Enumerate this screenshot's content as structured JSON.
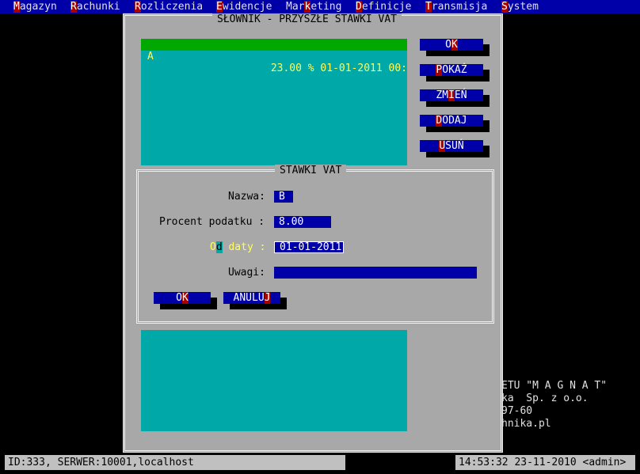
{
  "menu": [
    {
      "hot": "M",
      "rest": "agazyn"
    },
    {
      "hot": "R",
      "rest": "achunki"
    },
    {
      "hot": "R",
      "rest": "ozliczenia"
    },
    {
      "hot": "E",
      "rest": "widencje"
    },
    {
      "pre": "Mar",
      "hot": "k",
      "rest": "eting"
    },
    {
      "hot": "D",
      "rest": "efinicje"
    },
    {
      "hot": "T",
      "rest": "ransmisja"
    },
    {
      "hot": "S",
      "rest": "ystem"
    }
  ],
  "dialog_title": "SŁOWNIK - PRZYSZŁE STAWKI VAT",
  "list": {
    "selected_row": {
      "code": "A",
      "value": "23.00 % 01-01-2011 00:"
    }
  },
  "side_buttons": [
    {
      "pre": "O",
      "hot": "K",
      "rest": ""
    },
    {
      "pre": "",
      "hot": "P",
      "rest": "OKAŻ"
    },
    {
      "pre": "ZM",
      "hot": "I",
      "rest": "EŃ"
    },
    {
      "pre": "",
      "hot": "D",
      "rest": "ODAJ"
    },
    {
      "pre": "",
      "hot": "U",
      "rest": "SUŃ"
    }
  ],
  "form": {
    "title": "STAWKI VAT",
    "nazwa_label": "Nazwa:",
    "nazwa_value": "B",
    "procent_label": "Procent podatku :",
    "procent_value": "8.00",
    "od_label_pre": "O",
    "od_label_hot": "d",
    "od_label_rest": " daty :",
    "od_value": "01-01-2011",
    "uwagi_label": "Uwagi:",
    "uwagi_value": "",
    "ok": {
      "pre": "O",
      "hot": "K",
      "rest": ""
    },
    "anuluj": {
      "pre": "ANULU",
      "hot": "J",
      "rest": ""
    }
  },
  "background_text": [
    "ETU \"M A G N A T\"",
    "ka  Sp. z o.o.",
    "97-60",
    "hnika.pl"
  ],
  "status": {
    "left": "ID:333, SERWER:10001,localhost",
    "right": "14:53:32 23-11-2010 <admin>"
  }
}
